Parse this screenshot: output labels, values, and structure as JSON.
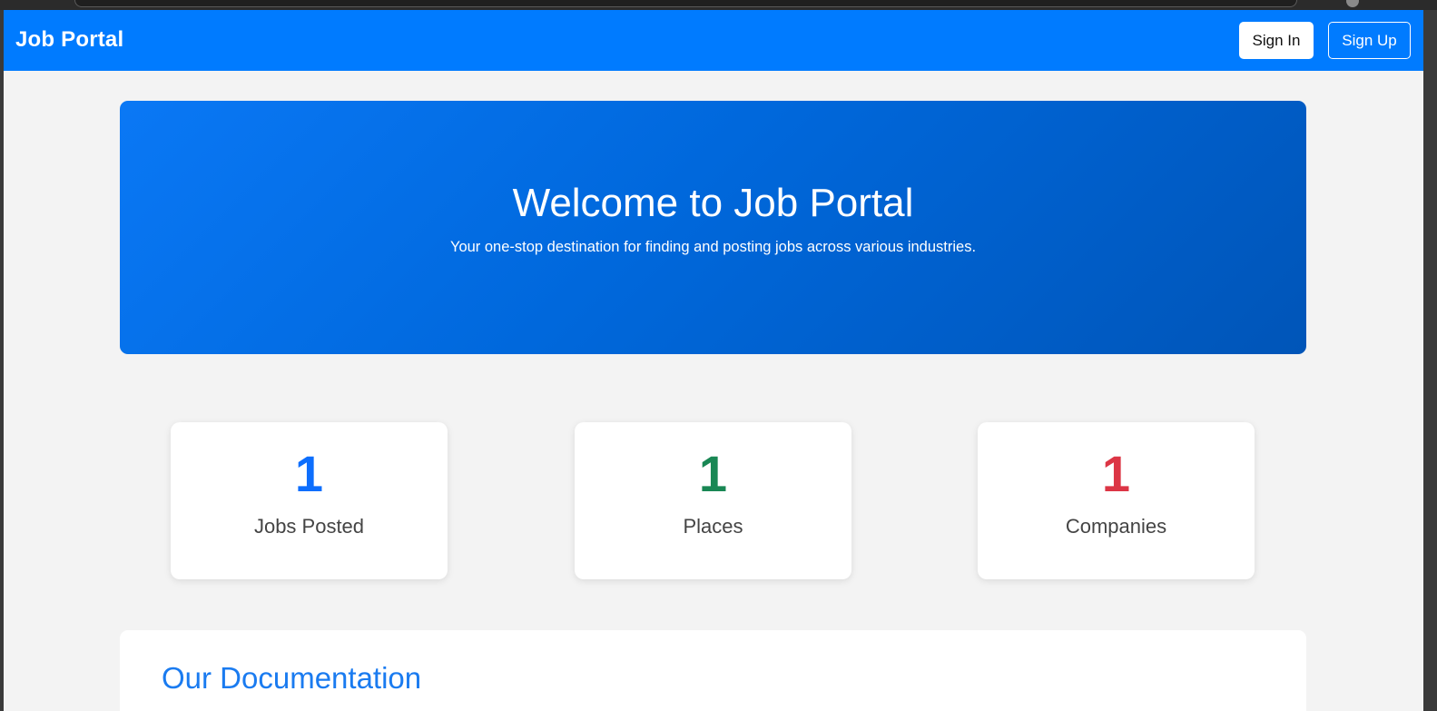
{
  "navbar": {
    "brand": "Job Portal",
    "signin_label": "Sign In",
    "signup_label": "Sign Up"
  },
  "hero": {
    "title": "Welcome to Job Portal",
    "subtitle": "Your one-stop destination for finding and posting jobs across various industries."
  },
  "stats": [
    {
      "value": "1",
      "label": "Jobs Posted",
      "color": "#0d6efd"
    },
    {
      "value": "1",
      "label": "Places",
      "color": "#198754"
    },
    {
      "value": "1",
      "label": "Companies",
      "color": "#dc3545"
    }
  ],
  "documentation": {
    "title": "Our Documentation"
  },
  "colors": {
    "primary": "#007bff",
    "background": "#f3f3f3"
  }
}
